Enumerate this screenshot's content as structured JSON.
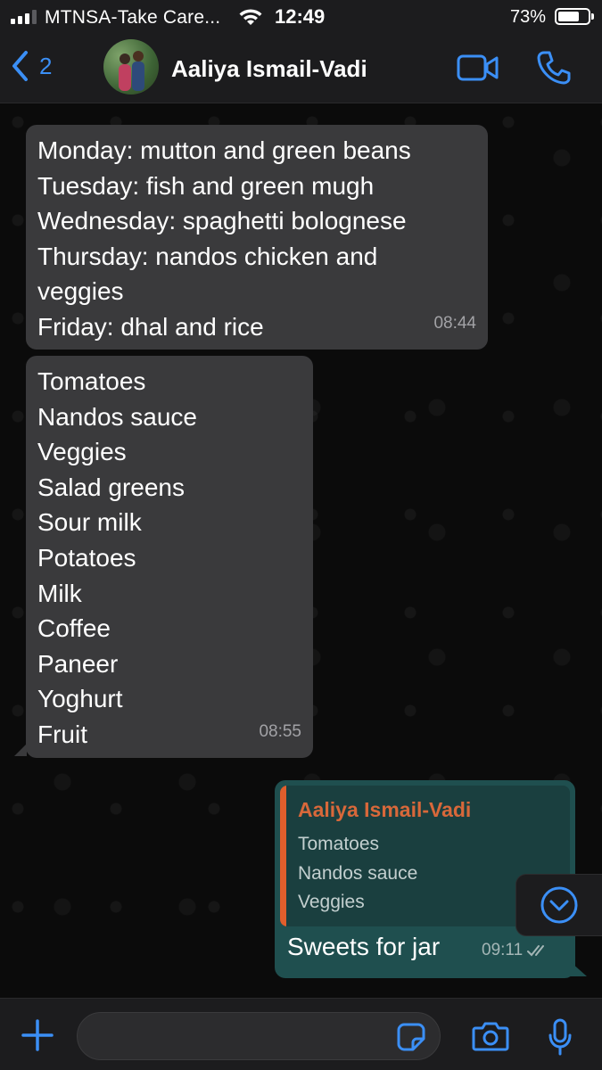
{
  "status_bar": {
    "carrier": "MTNSA-Take Care...",
    "time": "12:49",
    "battery_percent": "73%",
    "battery_level": 0.73,
    "signal_bars": 3
  },
  "header": {
    "back_count": "2",
    "contact_name": "Aaliya Ismail-Vadi",
    "icons": [
      "chevron-left-icon",
      "video-camera-icon",
      "phone-icon"
    ]
  },
  "messages": [
    {
      "direction": "incoming",
      "lines": [
        "Monday: mutton and green beans",
        "Tuesday: fish and green mugh",
        "Wednesday: spaghetti bolognese",
        "Thursday:  nandos chicken and",
        "veggies",
        "Friday: dhal and rice"
      ],
      "time": "08:44"
    },
    {
      "direction": "incoming",
      "lines": [
        "Tomatoes",
        "Nandos sauce",
        "Veggies",
        "Salad greens",
        "Sour milk",
        "Potatoes",
        "Milk",
        "Coffee",
        "Paneer",
        "Yoghurt",
        "Fruit"
      ],
      "time": "08:55"
    },
    {
      "direction": "outgoing",
      "quote": {
        "author": "Aaliya Ismail-Vadi",
        "lines": [
          "Tomatoes",
          "Nandos sauce",
          "Veggies"
        ]
      },
      "text": "Sweets for jar",
      "time": "09:11",
      "status": "read"
    }
  ],
  "input_bar": {
    "value": "",
    "icons": [
      "plus-icon",
      "sticker-icon",
      "camera-icon",
      "microphone-icon"
    ]
  },
  "colors": {
    "accent": "#3b8ff6",
    "incoming_bubble": "#3a3a3c",
    "outgoing_bubble": "#1f4f4f",
    "quote_accent": "#e05e2c"
  }
}
